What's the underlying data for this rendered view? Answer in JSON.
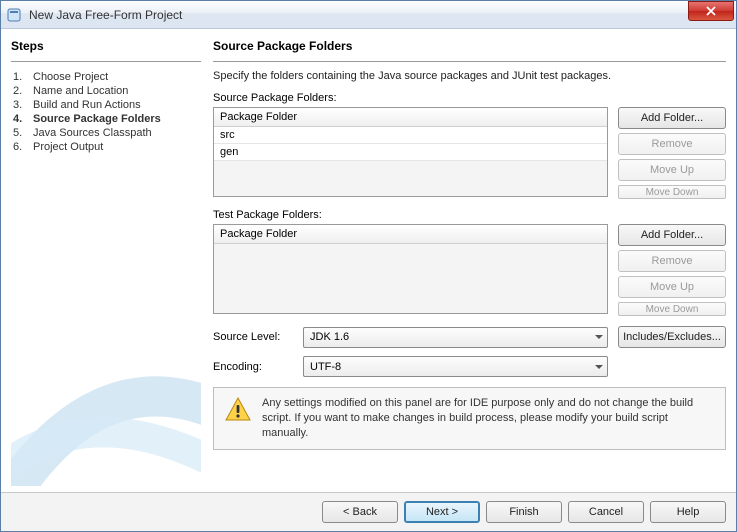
{
  "window": {
    "title": "New Java Free-Form Project"
  },
  "sidebar": {
    "heading": "Steps",
    "steps": [
      {
        "num": "1.",
        "label": "Choose Project"
      },
      {
        "num": "2.",
        "label": "Name and Location"
      },
      {
        "num": "3.",
        "label": "Build and Run Actions"
      },
      {
        "num": "4.",
        "label": "Source Package Folders"
      },
      {
        "num": "5.",
        "label": "Java Sources Classpath"
      },
      {
        "num": "6.",
        "label": "Project Output"
      }
    ],
    "active_index": 3
  },
  "main": {
    "heading": "Source Package Folders",
    "description": "Specify the folders containing the Java source packages and JUnit test packages.",
    "source_section_label": "Source Package Folders:",
    "test_section_label": "Test Package Folders:",
    "table_header": "Package Folder",
    "source_folders": [
      "src",
      "gen"
    ],
    "test_folders": [],
    "buttons": {
      "add_folder": "Add Folder...",
      "remove": "Remove",
      "move_up": "Move Up",
      "move_down": "Move Down",
      "includes": "Includes/Excludes..."
    },
    "source_level_label": "Source Level:",
    "source_level_value": "JDK 1.6",
    "encoding_label": "Encoding:",
    "encoding_value": "UTF-8",
    "info_text": "Any settings modified on this panel are for IDE purpose only and do not change the build script. If you want to make changes in build process, please modify your build script manually."
  },
  "footer": {
    "back": "< Back",
    "next": "Next >",
    "finish": "Finish",
    "cancel": "Cancel",
    "help": "Help"
  }
}
